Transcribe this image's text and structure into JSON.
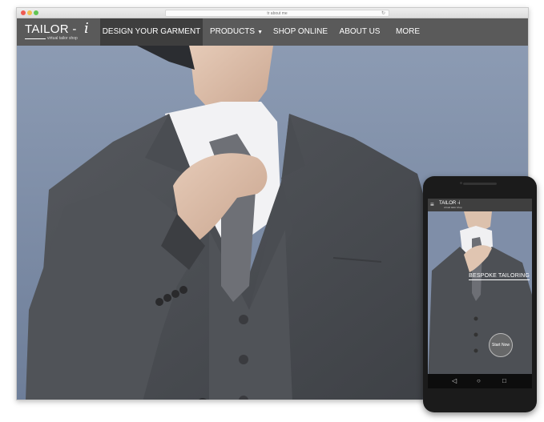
{
  "browser": {
    "url": "tr about me"
  },
  "nav": {
    "logo_text": "TAILOR -",
    "logo_i": "i",
    "logo_tagline": "virtual tailor shop",
    "items": [
      {
        "label": "DESIGN YOUR GARMENT",
        "active": true
      },
      {
        "label": "PRODUCTS",
        "has_dropdown": true
      },
      {
        "label": "SHOP ONLINE"
      },
      {
        "label": "ABOUT US"
      },
      {
        "label": "MORE"
      }
    ],
    "colors": {
      "bar": "#5a5a5a",
      "active": "#3e3e3e"
    }
  },
  "phone": {
    "logo_text": "TAILOR -i",
    "logo_tagline": "virtual tailor shop",
    "menu_icon": "hamburger-icon",
    "headline": "BESPOKE TAILORING",
    "cta": "Start Now",
    "softkeys": [
      "back-icon",
      "home-icon",
      "recents-icon"
    ]
  }
}
